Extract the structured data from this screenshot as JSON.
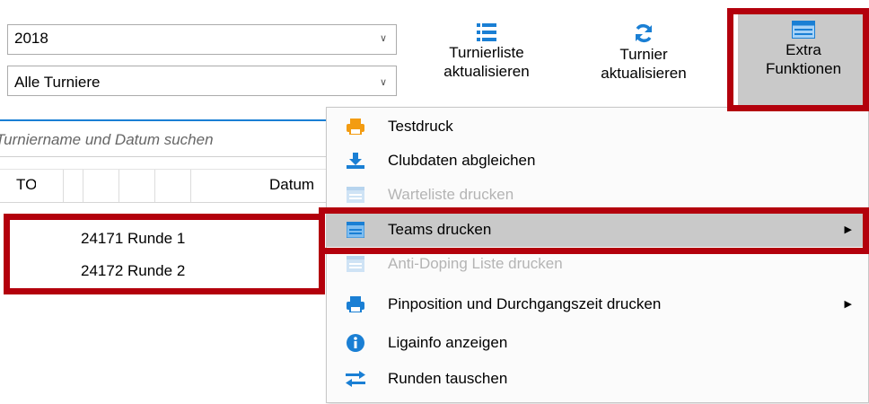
{
  "filters": {
    "year": "2018",
    "tournament_filter": "Alle Turniere"
  },
  "toolbar": {
    "turnierliste": [
      "Turnierliste",
      "aktualisieren"
    ],
    "turnier": [
      "Turnier",
      "aktualisieren"
    ],
    "extra": [
      "Extra",
      "Funktionen"
    ]
  },
  "search": {
    "placeholder": "Turniername und Datum suchen"
  },
  "table": {
    "headers": [
      "TO",
      "Datum"
    ],
    "rows": [
      "24171 Runde 1",
      "24172 Runde 2"
    ]
  },
  "menu": {
    "items": [
      {
        "label": "Testdruck",
        "icon": "printer-icon",
        "enabled": true,
        "submenu": false
      },
      {
        "label": "Clubdaten abgleichen",
        "icon": "download-icon",
        "enabled": true,
        "submenu": false
      },
      {
        "label": "Warteliste drucken",
        "icon": "list-icon",
        "enabled": false,
        "submenu": false
      },
      {
        "label": "Teams drucken",
        "icon": "list-icon",
        "enabled": true,
        "submenu": true,
        "highlighted": true
      },
      {
        "label": "Anti-Doping Liste drucken",
        "icon": "list-icon",
        "enabled": false,
        "submenu": false
      },
      {
        "label": "Pinposition und Durchgangszeit drucken",
        "icon": "printer-icon",
        "enabled": true,
        "submenu": true
      },
      {
        "label": "Ligainfo anzeigen",
        "icon": "info-icon",
        "enabled": true,
        "submenu": false
      },
      {
        "label": "Runden tauschen",
        "icon": "swap-icon",
        "enabled": true,
        "submenu": false
      }
    ]
  },
  "colors": {
    "accent_blue": "#1a7fd4",
    "printer_orange": "#f39c12",
    "highlight_red": "#b3000c",
    "menu_highlight": "#c9c9c9",
    "disabled_text": "#b4b4b4"
  }
}
